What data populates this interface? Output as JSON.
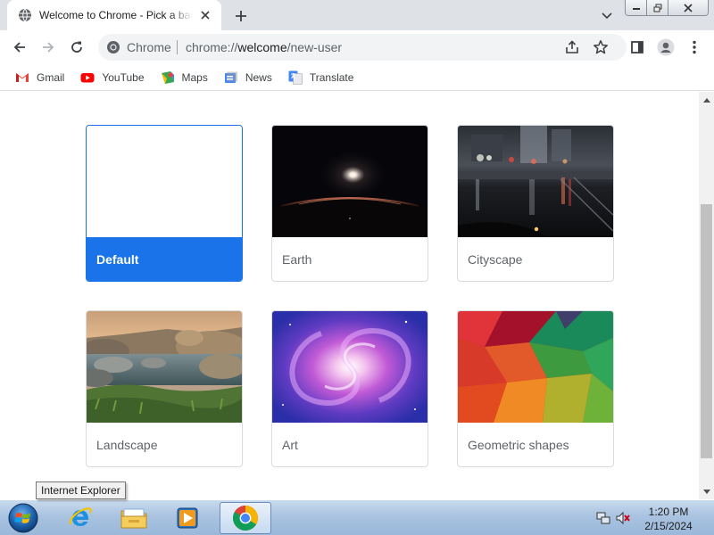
{
  "browser": {
    "tab": {
      "title": "Welcome to Chrome - Pick a background"
    },
    "omnibox": {
      "chip": "Chrome",
      "url_scheme": "chrome://",
      "url_host": "welcome",
      "url_path": "/new-user"
    },
    "bookmarks": [
      {
        "label": "Gmail",
        "icon": "gmail-icon"
      },
      {
        "label": "YouTube",
        "icon": "youtube-icon"
      },
      {
        "label": "Maps",
        "icon": "maps-icon"
      },
      {
        "label": "News",
        "icon": "news-icon"
      },
      {
        "label": "Translate",
        "icon": "translate-icon"
      }
    ]
  },
  "backgrounds": [
    {
      "label": "Default",
      "selected": true
    },
    {
      "label": "Earth",
      "selected": false
    },
    {
      "label": "Cityscape",
      "selected": false
    },
    {
      "label": "Landscape",
      "selected": false
    },
    {
      "label": "Art",
      "selected": false
    },
    {
      "label": "Geometric shapes",
      "selected": false
    }
  ],
  "tooltip": {
    "text": "Internet Explorer"
  },
  "taskbar": {
    "clock_time": "1:20 PM",
    "clock_date": "2/15/2024",
    "items": [
      "start-orb-icon",
      "internet-explorer-icon",
      "file-explorer-icon",
      "media-player-icon",
      "chrome-icon"
    ]
  },
  "colors": {
    "accent": "#1a73e8",
    "tabstrip": "#dee1e6",
    "taskbar": "#a9c3e0"
  }
}
